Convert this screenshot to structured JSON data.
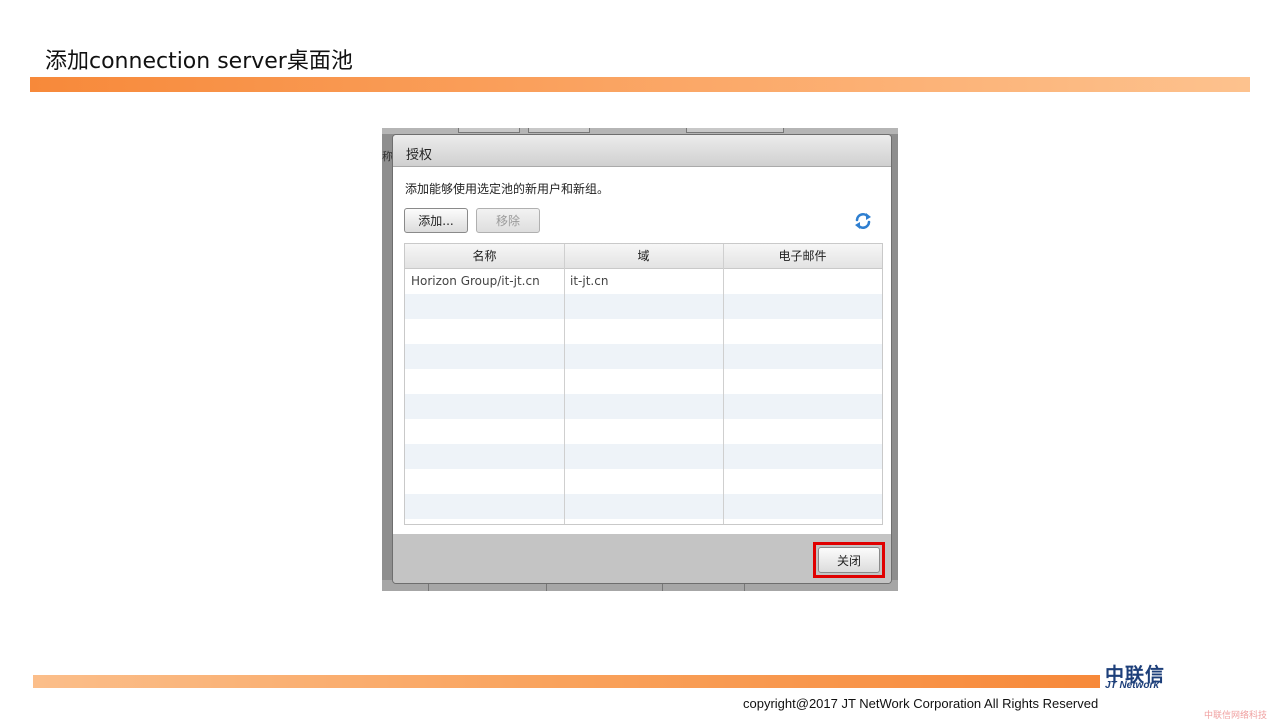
{
  "slide": {
    "title": "添加connection server桌面池",
    "copyright": "copyright@2017  JT NetWork Corporation All Rights Reserved",
    "logo_main": "中联信",
    "logo_sub": "JT Network",
    "watermark": "中联信网络科技"
  },
  "background": {
    "left_fragment": "称"
  },
  "dialog": {
    "title": "授权",
    "description": "添加能够使用选定池的新用户和新组。",
    "add_label": "添加...",
    "remove_label": "移除",
    "close_label": "关闭",
    "table": {
      "columns": [
        "名称",
        "域",
        "电子邮件"
      ],
      "rows": [
        [
          "Horizon Group/it-jt.cn",
          "it-jt.cn",
          ""
        ]
      ]
    }
  },
  "colors": {
    "accent_orange": "#f7893a",
    "highlight_red": "#e00000",
    "logo_blue": "#1d3f7a",
    "refresh_icon": "#2f7fd0"
  },
  "icons": [
    "refresh-icon"
  ]
}
